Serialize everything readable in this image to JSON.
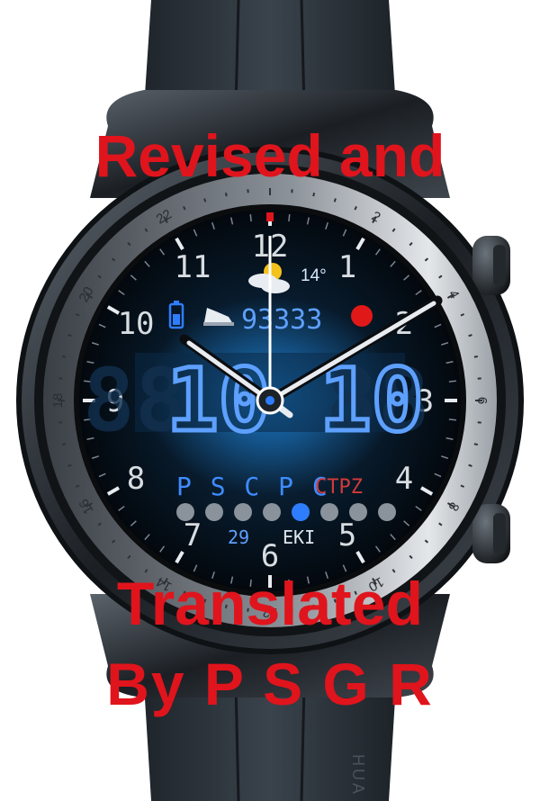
{
  "overlay": {
    "line1": "Revised and",
    "line2": "Translated",
    "line3": "By  P S G R"
  },
  "watch": {
    "strap_brand": "HUA",
    "bezel_numbers": [
      "2",
      "4",
      "6",
      "8",
      "10",
      "12",
      "14",
      "16",
      "18",
      "20",
      "22"
    ],
    "dial_numbers": [
      "12",
      "1",
      "2",
      "3",
      "4",
      "5",
      "6",
      "7",
      "8",
      "9",
      "10",
      "11"
    ],
    "weather": {
      "icon": "partly-cloudy-icon",
      "temperature": "14°"
    },
    "steps": "93333",
    "time": {
      "hours": "10",
      "minutes": "10",
      "dim_hours": "88",
      "dim_minutes": "88"
    },
    "weekdays_text": "P S C P C",
    "active_weekday": "CTPZ",
    "date_day": "29",
    "date_month": "EKI",
    "dots": {
      "count": 8,
      "active_index": 4
    },
    "colors": {
      "accent": "#2f7dff",
      "digits": "#5ea0ff",
      "overlay": "#e0141c",
      "red_dot": "#e01818"
    }
  }
}
